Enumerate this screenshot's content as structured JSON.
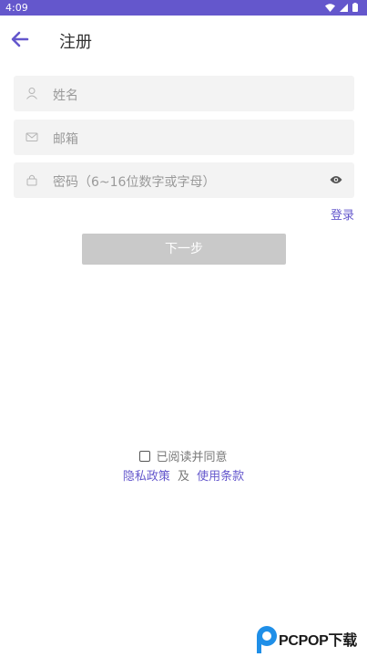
{
  "status_bar": {
    "time": "4:09"
  },
  "header": {
    "title": "注册"
  },
  "form": {
    "name_placeholder": "姓名",
    "email_placeholder": "邮箱",
    "password_placeholder": "密码（6~16位数字或字母）"
  },
  "login_link": "登录",
  "next_button": "下一步",
  "agreement": {
    "checkbox_label": "已阅读并同意",
    "privacy_policy": "隐私政策",
    "and": "及",
    "terms_of_use": "使用条款"
  },
  "watermark": {
    "brand": "PCPOP下载"
  },
  "colors": {
    "accent": "#6457cc",
    "field_bg": "#f3f3f3",
    "button_disabled": "#c9c9c9"
  }
}
